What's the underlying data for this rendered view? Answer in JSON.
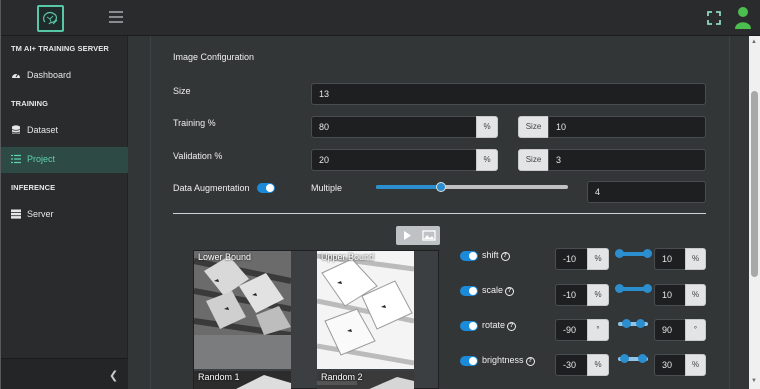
{
  "sidebar": {
    "app_title": "TM AI+ TRAINING SERVER",
    "sections": {
      "training": "TRAINING",
      "inference": "INFERENCE"
    },
    "items": {
      "dashboard": "Dashboard",
      "dataset": "Dataset",
      "project": "Project",
      "server": "Server"
    }
  },
  "config": {
    "heading": "Image Configuration",
    "size_label": "Size",
    "size_value": "13",
    "training_label": "Training %",
    "training_value": "80",
    "training_unit": "%",
    "training_size_label": "Size",
    "training_size_value": "10",
    "validation_label": "Validation %",
    "validation_value": "20",
    "validation_unit": "%",
    "validation_size_label": "Size",
    "validation_size_value": "3",
    "augmentation_label": "Data Augmentation",
    "augmentation_enabled": true,
    "multiple_label": "Multiple",
    "multiple_value": "4",
    "multiple_slider_fraction": 0.34
  },
  "preview": {
    "lower_bound": "Lower Bound",
    "upper_bound": "Upper Bound",
    "random_1": "Random 1",
    "random_2": "Random 2"
  },
  "augmentation": [
    {
      "name": "shift",
      "min": "-10",
      "min_unit": "%",
      "max": "10",
      "max_unit": "%"
    },
    {
      "name": "scale",
      "min": "-10",
      "min_unit": "%",
      "max": "10",
      "max_unit": "%"
    },
    {
      "name": "rotate",
      "min": "-90",
      "min_unit": "°",
      "max": "90",
      "max_unit": "°"
    },
    {
      "name": "brightness",
      "min": "-30",
      "min_unit": "%",
      "max": "30",
      "max_unit": "%"
    }
  ],
  "colors": {
    "accent": "#57c7a6",
    "active_text": "#5ed3b0",
    "toggle": "#1a8ad9",
    "slider": "#2b8fcf"
  }
}
